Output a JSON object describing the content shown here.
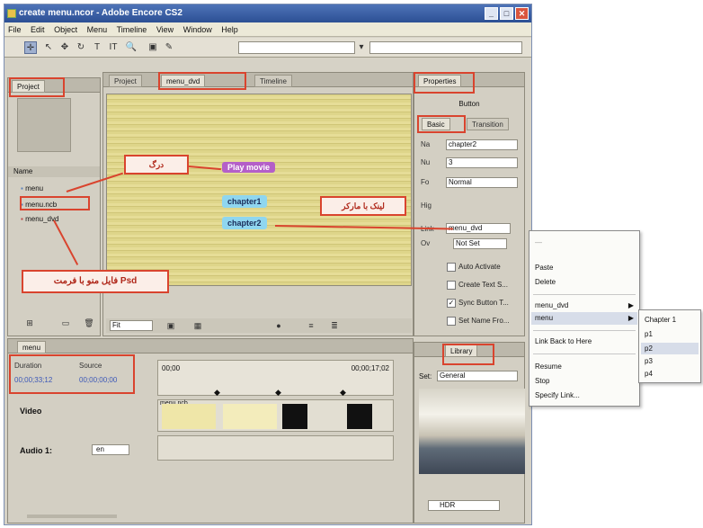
{
  "window": {
    "title": "create menu.ncor - Adobe Encore CS2",
    "min": "_",
    "max": "□",
    "close": "✕"
  },
  "menubar": [
    "File",
    "Edit",
    "Object",
    "Menu",
    "Timeline",
    "View",
    "Window",
    "Help"
  ],
  "project_panel": {
    "tab": "Project",
    "list_header": "Name",
    "items": [
      "menu",
      "menu.ncb",
      "menu_dvd"
    ]
  },
  "center": {
    "tabs": [
      "Project",
      "menu_dvd",
      "Timeline"
    ],
    "zoom": "Fit",
    "buttons": {
      "play": "Play movie",
      "chapter1": "chapter1",
      "chapter2": "chapter2"
    }
  },
  "callouts": {
    "drag": "درگ",
    "link": "لینک با مارکر",
    "psd": "فایل منو با فرمت Psd"
  },
  "properties": {
    "tab": "Properties",
    "type": "Button",
    "subtabs": [
      "Basic",
      "Transition"
    ],
    "rows": [
      {
        "label": "Na",
        "value": "chapter2"
      },
      {
        "label": "Nu",
        "value": "3"
      },
      {
        "label": "Fo",
        "value": "Normal"
      },
      {
        "label": "Hig",
        "value": ""
      },
      {
        "label": "Link",
        "value": "menu_dvd"
      },
      {
        "label": "Ov",
        "value": "Not Set"
      }
    ],
    "checks": [
      "Auto Activate",
      "Create Text S...",
      "Sync Button T...",
      "Set Name Fro..."
    ]
  },
  "context_menu": {
    "items": [
      "Paste",
      "Delete",
      "menu_dvd",
      "menu",
      "Link Back to Here",
      "Resume",
      "Stop",
      "Specify Link..."
    ],
    "submenu": [
      "Chapter 1",
      "p1",
      "p2",
      "p3",
      "p4"
    ]
  },
  "timeline": {
    "tab": "menu",
    "labels": {
      "duration": "Duration",
      "source": "Source"
    },
    "values": {
      "duration": "00;00;33;12",
      "source": "00;00;00;00"
    },
    "ruler_start": "00;00",
    "ruler_end": "00;00;17;02",
    "video_label": "Video",
    "audio_label": "Audio 1:",
    "audio_select": "en",
    "clip_name": "menu.ncb"
  },
  "library": {
    "tab": "Library",
    "set_label": "Set:",
    "set_value": "General",
    "item_name": "HDR"
  },
  "colors": {
    "annotation_red": "#d9442e",
    "play_button": "#b45fc8",
    "chapter_button": "#8fd6ef"
  }
}
